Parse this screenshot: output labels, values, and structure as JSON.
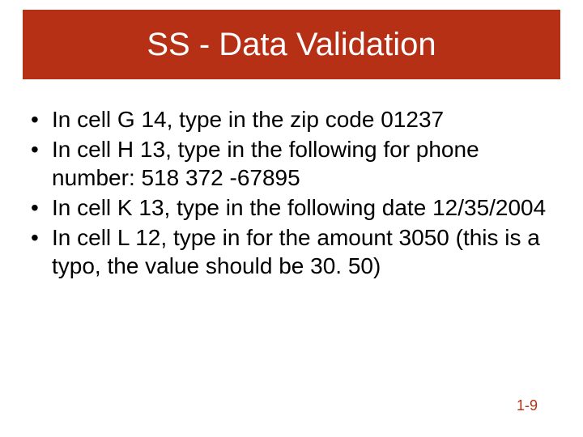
{
  "title": "SS - Data Validation",
  "bullets": [
    "In cell G 14, type in the zip code 01237",
    "In cell H 13, type in the following for phone number: 518 372 -67895",
    "In cell K 13, type in the following date 12/35/2004",
    "In cell L 12, type in for the amount 3050 (this is a typo, the value should be 30. 50)"
  ],
  "footer": "1-9"
}
